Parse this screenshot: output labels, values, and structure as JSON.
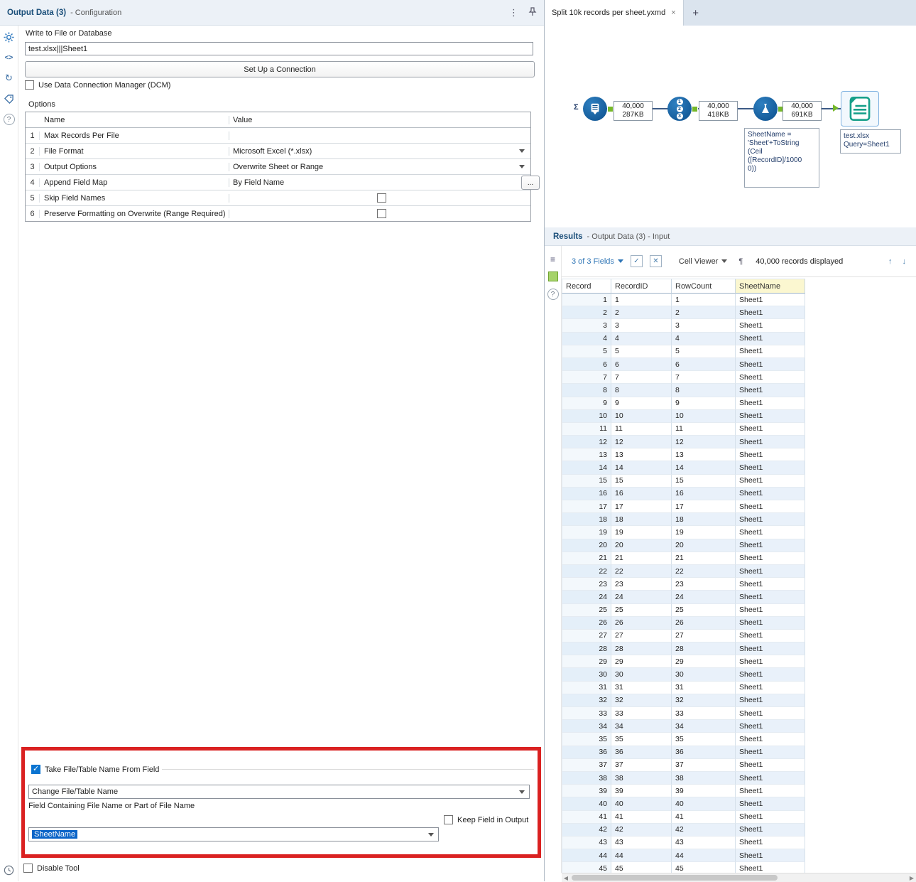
{
  "config": {
    "title": "Output Data (3)",
    "subtitle": "- Configuration",
    "write_label": "Write to File or Database",
    "file_value": "test.xlsx|||Sheet1",
    "setup_button": "Set Up a Connection",
    "dcm_label": "Use Data Connection Manager (DCM)",
    "dcm_checked": false,
    "options_label": "Options",
    "options_table": {
      "headers": [
        "Name",
        "Value"
      ],
      "rows": [
        {
          "num": "1",
          "name": "Max Records Per File",
          "value": ""
        },
        {
          "num": "2",
          "name": "File Format",
          "value": "Microsoft Excel (*.xlsx)"
        },
        {
          "num": "3",
          "name": "Output Options",
          "value": "Overwrite Sheet or Range"
        },
        {
          "num": "4",
          "name": "Append Field Map",
          "value": "By Field Name",
          "ellipsis": "..."
        },
        {
          "num": "5",
          "name": "Skip Field Names",
          "value": "",
          "checked": false
        },
        {
          "num": "6",
          "name": "Preserve Formatting on Overwrite (Range Required)",
          "value": "",
          "checked": false
        }
      ]
    },
    "take_group": {
      "checkbox_label": "Take File/Table Name From Field",
      "checkbox_checked": true,
      "name_dropdown_value": "Change File/Table Name",
      "field_label": "Field Containing File Name or Part of File Name",
      "field_value": "SheetName",
      "keep_label": "Keep Field in Output",
      "keep_checked": false
    },
    "disable_label": "Disable Tool",
    "disable_checked": false
  },
  "canvas": {
    "tab_title": "Split 10k records per sheet.yxmd",
    "tab_close": "×",
    "new_tab": "+",
    "sigma": "Σ",
    "recordid_digits": [
      "1",
      "2",
      "3"
    ],
    "badges": [
      {
        "records": "40,000",
        "size": "287KB"
      },
      {
        "records": "40,000",
        "size": "418KB"
      },
      {
        "records": "40,000",
        "size": "691KB"
      }
    ],
    "annotation": "SheetName =\n'Sheet'+ToString\n(Ceil\n([RecordID]/1000\n0))",
    "output_annotation": "test.xlsx\nQuery=Sheet1"
  },
  "results": {
    "title": "Results",
    "subtitle": "- Output Data (3) - Input",
    "fields_dropdown": "3 of 3 Fields",
    "cell_viewer": "Cell Viewer",
    "records_displayed": "40,000 records displayed",
    "pilcrow": "¶",
    "columns": [
      "Record",
      "RecordID",
      "RowCount",
      "SheetName"
    ],
    "rows": [
      [
        1,
        1,
        1,
        "Sheet1"
      ],
      [
        2,
        2,
        2,
        "Sheet1"
      ],
      [
        3,
        3,
        3,
        "Sheet1"
      ],
      [
        4,
        4,
        4,
        "Sheet1"
      ],
      [
        5,
        5,
        5,
        "Sheet1"
      ],
      [
        6,
        6,
        6,
        "Sheet1"
      ],
      [
        7,
        7,
        7,
        "Sheet1"
      ],
      [
        8,
        8,
        8,
        "Sheet1"
      ],
      [
        9,
        9,
        9,
        "Sheet1"
      ],
      [
        10,
        10,
        10,
        "Sheet1"
      ],
      [
        11,
        11,
        11,
        "Sheet1"
      ],
      [
        12,
        12,
        12,
        "Sheet1"
      ],
      [
        13,
        13,
        13,
        "Sheet1"
      ],
      [
        14,
        14,
        14,
        "Sheet1"
      ],
      [
        15,
        15,
        15,
        "Sheet1"
      ],
      [
        16,
        16,
        16,
        "Sheet1"
      ],
      [
        17,
        17,
        17,
        "Sheet1"
      ],
      [
        18,
        18,
        18,
        "Sheet1"
      ],
      [
        19,
        19,
        19,
        "Sheet1"
      ],
      [
        20,
        20,
        20,
        "Sheet1"
      ],
      [
        21,
        21,
        21,
        "Sheet1"
      ],
      [
        22,
        22,
        22,
        "Sheet1"
      ],
      [
        23,
        23,
        23,
        "Sheet1"
      ],
      [
        24,
        24,
        24,
        "Sheet1"
      ],
      [
        25,
        25,
        25,
        "Sheet1"
      ],
      [
        26,
        26,
        26,
        "Sheet1"
      ],
      [
        27,
        27,
        27,
        "Sheet1"
      ],
      [
        28,
        28,
        28,
        "Sheet1"
      ],
      [
        29,
        29,
        29,
        "Sheet1"
      ],
      [
        30,
        30,
        30,
        "Sheet1"
      ],
      [
        31,
        31,
        31,
        "Sheet1"
      ],
      [
        32,
        32,
        32,
        "Sheet1"
      ],
      [
        33,
        33,
        33,
        "Sheet1"
      ],
      [
        34,
        34,
        34,
        "Sheet1"
      ],
      [
        35,
        35,
        35,
        "Sheet1"
      ],
      [
        36,
        36,
        36,
        "Sheet1"
      ],
      [
        37,
        37,
        37,
        "Sheet1"
      ],
      [
        38,
        38,
        38,
        "Sheet1"
      ],
      [
        39,
        39,
        39,
        "Sheet1"
      ],
      [
        40,
        40,
        40,
        "Sheet1"
      ],
      [
        41,
        41,
        41,
        "Sheet1"
      ],
      [
        42,
        42,
        42,
        "Sheet1"
      ],
      [
        43,
        43,
        43,
        "Sheet1"
      ],
      [
        44,
        44,
        44,
        "Sheet1"
      ],
      [
        45,
        45,
        45,
        "Sheet1"
      ]
    ]
  }
}
